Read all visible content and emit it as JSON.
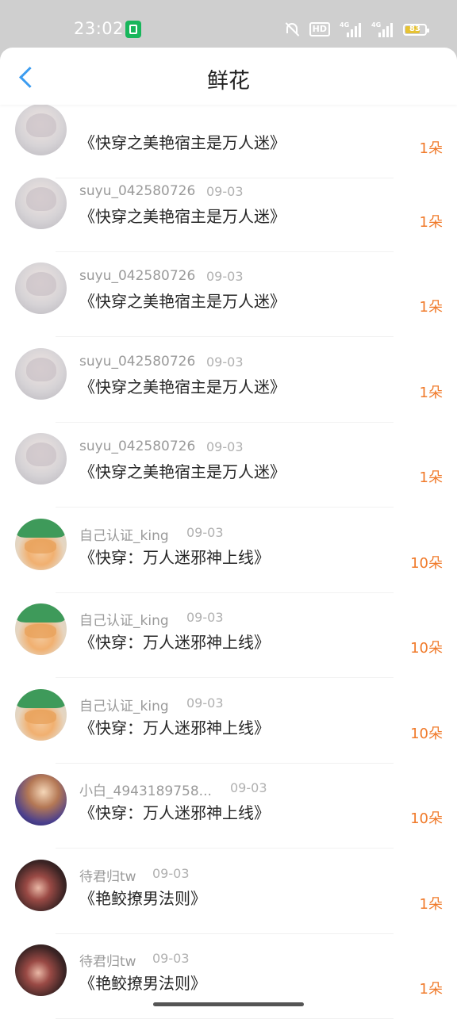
{
  "status_bar": {
    "time": "23:02",
    "hd_label": "HD",
    "signal1_label": "4G",
    "signal2_label": "4G",
    "battery_level": "83"
  },
  "nav": {
    "title": "鲜花",
    "back_icon": "chevron-left-icon"
  },
  "colors": {
    "accent": "#3b9cf0",
    "count_color": "#f07a2a"
  },
  "rows": [
    {
      "username": "",
      "date": "",
      "book": "《快穿之美艳宿主是万人迷》",
      "count": "1朵",
      "avatar": "a1"
    },
    {
      "username": "suyu_042580726",
      "date": "09-03",
      "book": "《快穿之美艳宿主是万人迷》",
      "count": "1朵",
      "avatar": "a1"
    },
    {
      "username": "suyu_042580726",
      "date": "09-03",
      "book": "《快穿之美艳宿主是万人迷》",
      "count": "1朵",
      "avatar": "a1"
    },
    {
      "username": "suyu_042580726",
      "date": "09-03",
      "book": "《快穿之美艳宿主是万人迷》",
      "count": "1朵",
      "avatar": "a1"
    },
    {
      "username": "suyu_042580726",
      "date": "09-03",
      "book": "《快穿之美艳宿主是万人迷》",
      "count": "1朵",
      "avatar": "a1"
    },
    {
      "username": "自己认证_king",
      "date": "09-03",
      "book": "《快穿：万人迷邪神上线》",
      "count": "10朵",
      "avatar": "a2"
    },
    {
      "username": "自己认证_king",
      "date": "09-03",
      "book": "《快穿：万人迷邪神上线》",
      "count": "10朵",
      "avatar": "a2"
    },
    {
      "username": "自己认证_king",
      "date": "09-03",
      "book": "《快穿：万人迷邪神上线》",
      "count": "10朵",
      "avatar": "a2"
    },
    {
      "username": "小白_4943189758...",
      "date": "09-03",
      "book": "《快穿：万人迷邪神上线》",
      "count": "10朵",
      "avatar": "a3"
    },
    {
      "username": "待君归tw",
      "date": "09-03",
      "book": "《艳鲛撩男法则》",
      "count": "1朵",
      "avatar": "a4"
    },
    {
      "username": "待君归tw",
      "date": "09-03",
      "book": "《艳鲛撩男法则》",
      "count": "1朵",
      "avatar": "a4"
    }
  ]
}
